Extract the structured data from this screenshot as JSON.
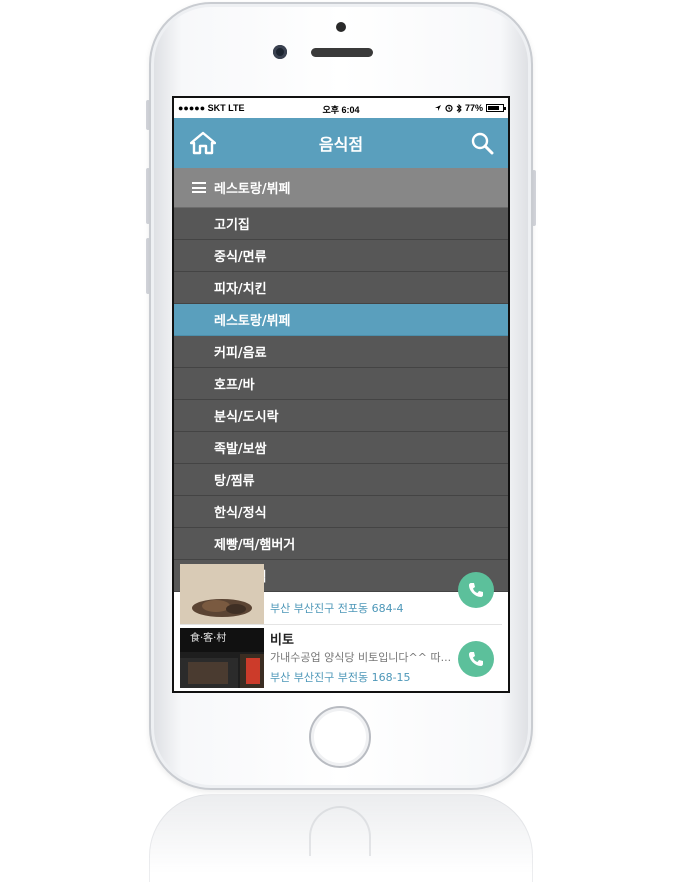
{
  "status_bar": {
    "carrier": "●●●●● SKT  LTE",
    "time": "오후 6:04",
    "battery_text": "77%"
  },
  "header": {
    "title": "음식점",
    "home_icon": "home-icon",
    "search_icon": "search-icon"
  },
  "category": {
    "selected": "레스토랑/뷔페",
    "icon": "hamburger-icon"
  },
  "menu": {
    "items": [
      {
        "label": "고기집"
      },
      {
        "label": "중식/면류"
      },
      {
        "label": "피자/치킨"
      },
      {
        "label": "레스토랑/뷔페",
        "active": true
      },
      {
        "label": "커피/음료"
      },
      {
        "label": "호프/바"
      },
      {
        "label": "분식/도시락"
      },
      {
        "label": "족발/보쌈"
      },
      {
        "label": "탕/찜류"
      },
      {
        "label": "한식/정식"
      },
      {
        "label": "제빵/떡/햄버거"
      },
      {
        "label": "횟집/일식"
      }
    ]
  },
  "listings": [
    {
      "address": "부산 부산진구 전포동 684-4"
    },
    {
      "name": "비토",
      "description": "가내수공업 양식당 비토입니다^^ 따...",
      "address": "부산 부산진구 부전동 168-15"
    }
  ],
  "colors": {
    "header_bg": "#5a9fbd",
    "menu_bg": "#575757",
    "category_bg": "#878787",
    "call_button": "#5cc09b",
    "address_text": "#4d97b8"
  }
}
